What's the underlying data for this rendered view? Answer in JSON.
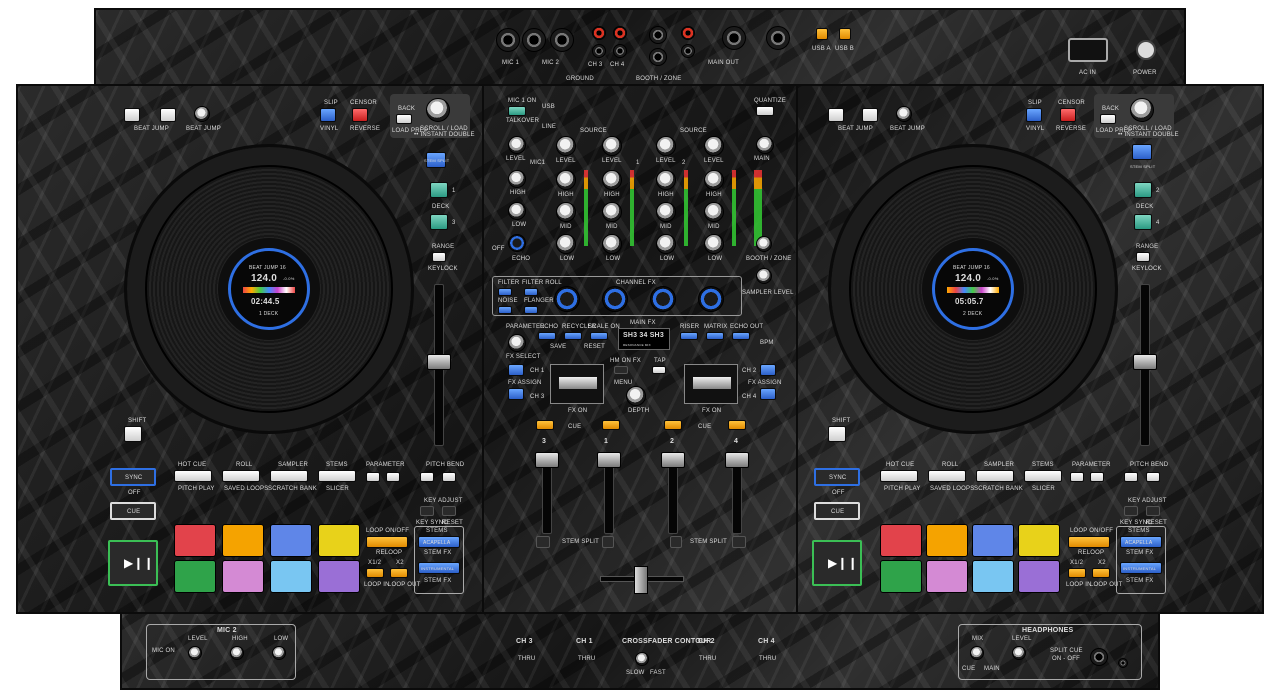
{
  "rear": {
    "mic1": "MIC 1",
    "mic2": "MIC 2",
    "ch3": "CH 3",
    "ch4": "CH 4",
    "ground": "GROUND",
    "booth_zone": "BOOTH / ZONE",
    "main_out": "MAIN OUT",
    "usb_a": "USB A",
    "usb_b": "USB B",
    "ac_in": "AC IN",
    "power": "POWER"
  },
  "deck_left": {
    "beat_jump": "BEAT JUMP",
    "beat_jump_length": "BEAT JUMP\nLENGTH",
    "slip": "SLIP",
    "vinyl": "VINYL",
    "censor": "CENSOR",
    "reverse": "REVERSE",
    "back": "BACK",
    "load_prep": "LOAD PREP",
    "scroll_load": "SCROLL / LOAD",
    "instant_double": "•• INSTANT DOUBLE",
    "stem_split": "STEM SPLIT",
    "deck": "DECK",
    "deck_num_a": "1",
    "deck_num_b": "3",
    "range": "RANGE",
    "keylock": "KEYLOCK",
    "screen": {
      "beat_jump_value": "BEAT JUMP 16",
      "bpm": "124.0",
      "pitch": "-0.0%",
      "time": "02:44.5",
      "deck": "1 DECK"
    },
    "shift": "SHIFT",
    "sync": "SYNC",
    "off": "OFF",
    "cue": "CUE",
    "hot_cue": "HOT CUE",
    "roll": "ROLL",
    "sampler": "SAMPLER",
    "stems": "STEMS",
    "pitch_play": "PITCH PLAY",
    "saved_loops": "SAVED LOOPS",
    "scratch_bank": "SCRATCH BANK",
    "slicer": "SLICER",
    "parameter": "PARAMETER",
    "pitch_bend": "PITCH BEND",
    "key_adjust": "KEY ADJUST",
    "key_sync": "KEY SYNC",
    "reset": "RESET",
    "stems_label": "STEMS",
    "acapella": "ACAPELLA",
    "stem_fx": "STEM FX",
    "instrumental": "INSTRUMENTAL",
    "stem_fx_2": "STEM FX",
    "loop_on_off": "LOOP ON/OFF",
    "reloop": "RELOOP",
    "x12": "x1/2",
    "x2": "x2",
    "loop_in": "LOOP IN",
    "loop_out": "LOOP OUT"
  },
  "deck_right": {
    "beat_jump": "BEAT JUMP",
    "beat_jump_length": "BEAT JUMP\nLENGTH",
    "slip": "SLIP",
    "vinyl": "VINYL",
    "censor": "CENSOR",
    "reverse": "REVERSE",
    "back": "BACK",
    "load_prep": "LOAD PREP",
    "scroll_load": "SCROLL / LOAD",
    "instant_double": "•• INSTANT DOUBLE",
    "stem_split": "STEM SPLIT",
    "deck": "DECK",
    "deck_num_a": "2",
    "deck_num_b": "4",
    "range": "RANGE",
    "keylock": "KEYLOCK",
    "screen": {
      "beat_jump_value": "BEAT JUMP 16",
      "bpm": "124.0",
      "pitch": "-0.0%",
      "time": "05:05.7",
      "deck": "2 DECK"
    },
    "shift": "SHIFT",
    "sync": "SYNC",
    "off": "OFF",
    "cue": "CUE",
    "hot_cue": "HOT CUE",
    "roll": "ROLL",
    "sampler": "SAMPLER",
    "stems": "STEMS",
    "pitch_play": "PITCH PLAY",
    "saved_loops": "SAVED LOOPS",
    "scratch_bank": "SCRATCH BANK",
    "slicer": "SLICER",
    "parameter": "PARAMETER",
    "pitch_bend": "PITCH BEND",
    "key_adjust": "KEY ADJUST",
    "key_sync": "KEY SYNC",
    "reset": "RESET",
    "stems_label": "STEMS",
    "acapella": "ACAPELLA",
    "stem_fx": "STEM FX",
    "instrumental": "INSTRUMENTAL",
    "stem_fx_2": "STEM FX",
    "loop_on_off": "LOOP ON/OFF",
    "reloop": "RELOOP",
    "x12": "x1/2",
    "x2": "x2",
    "loop_in": "LOOP IN",
    "loop_out": "LOOP OUT"
  },
  "mixer": {
    "mic1_on": "MIC 1 ON",
    "talkover": "TALKOVER",
    "usb": "USB",
    "line": "LINE",
    "source": "SOURCE",
    "quantize": "QUANTIZE",
    "level": "LEVEL",
    "mic1": "MIC1",
    "high": "HIGH",
    "mid": "MID",
    "low": "LOW",
    "echo": "ECHO",
    "off": "OFF",
    "main": "MAIN",
    "booth_zone": "BOOTH / ZONE",
    "sampler_level": "SAMPLER LEVEL",
    "ch_nums": [
      "1",
      "2",
      "3",
      "4"
    ],
    "filter": "FILTER",
    "filter_roll": "FILTER ROLL",
    "noise": "NOISE",
    "flanger": "FLANGER",
    "channel_fx": "CHANNEL FX",
    "parameter": "PARAMETER",
    "fx_select": "FX SELECT",
    "echo_fx": "ECHO",
    "recycler": "RECYCLER",
    "scale_on": "SCALE ON",
    "main_fx": "MAIN FX",
    "riser": "RISER",
    "matrix": "MATRIX",
    "echo_out": "ECHO OUT",
    "save": "SAVE",
    "reset": "RESET",
    "display": "SH3 34 SH3",
    "display_sub": "RESONANCE MIX",
    "ch1": "CH 1",
    "ch3": "CH 3",
    "ch2": "CH 2",
    "ch4": "CH 4",
    "fx_assign": "FX ASSIGN",
    "fx_on": "FX ON",
    "bpm": "BPM",
    "tap": "TAP",
    "hm_on_fx": "HM ON FX",
    "menu": "MENU",
    "depth": "DEPTH",
    "cue": "CUE",
    "stem_split": "STEM SPLIT"
  },
  "front": {
    "mic2": "MIC 2",
    "mic_on": "MIC ON",
    "level": "LEVEL",
    "high": "HIGH",
    "low": "LOW",
    "ch3": "CH 3",
    "ch1": "CH 1",
    "crossfader_contour": "CROSSFADER CONTOUR",
    "ch2": "CH 2",
    "ch4": "CH 4",
    "thru": "THRU",
    "slow": "SLOW",
    "fast": "FAST",
    "headphones": "HEADPHONES",
    "mix": "MIX",
    "split_cue": "SPLIT CUE",
    "split_cue_state": "ON - OFF",
    "cue": "CUE",
    "main": "MAIN"
  },
  "colors": {
    "blue": "#2e6fe3",
    "red": "#d62828",
    "teal": "#3aa88f",
    "orange": "#f29a00",
    "pads": [
      "#e2434b",
      "#f5a300",
      "#5f86e8",
      "#e8d21a",
      "#2fa34a",
      "#d48ad4",
      "#79c6f2",
      "#9a6fd6"
    ]
  }
}
